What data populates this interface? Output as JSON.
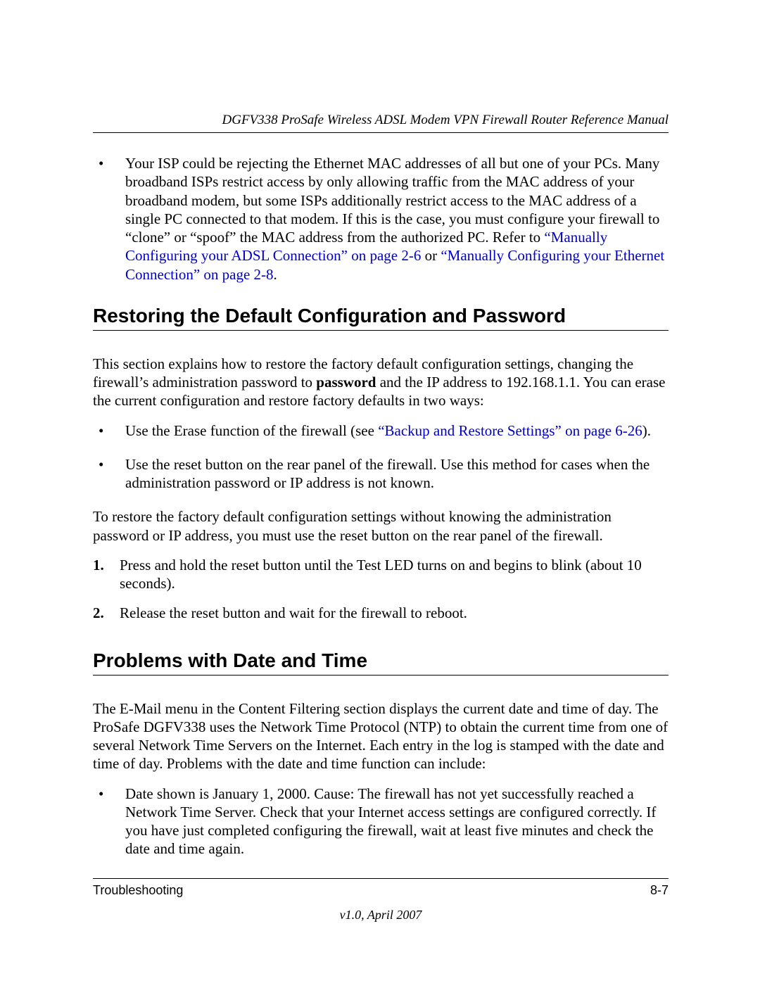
{
  "header": {
    "title": "DGFV338 ProSafe Wireless ADSL Modem VPN Firewall Router Reference Manual"
  },
  "top_bullet": {
    "pre": "Your ISP could be rejecting the Ethernet MAC addresses of all but one of your PCs. Many broadband ISPs restrict access by only allowing traffic from the MAC address of your broadband modem, but some ISPs additionally restrict access to the MAC address of a single PC connected to that modem. If this is the case, you must configure your firewall to “clone” or “spoof” the MAC address from the authorized PC. Refer to ",
    "link1": "“Manually Configuring your ADSL Connection” on page 2-6",
    "mid": " or ",
    "link2": "“Manually Configuring your Ethernet Connection” on page 2-8",
    "post": "."
  },
  "section1": {
    "heading": "Restoring the Default Configuration and Password",
    "intro_pre": "This section explains how to restore the factory default configuration settings, changing the firewall’s administration password to ",
    "intro_bold": "password",
    "intro_post": " and the IP address to 192.168.1.1. You can erase the current configuration and restore factory defaults in two ways:",
    "bullet1_pre": "Use the Erase function of the firewall (see ",
    "bullet1_link": "“Backup and Restore Settings” on page 6-26",
    "bullet1_post": ").",
    "bullet2": "Use the reset button on the rear panel of the firewall. Use this method for cases when the administration password or IP address is not known.",
    "para2": "To restore the factory default configuration settings without knowing the administration password or IP address, you must use the reset button on the rear panel of the firewall.",
    "step1_num": "1.",
    "step1": "Press and hold the reset button until the Test LED turns on and begins to blink (about 10 seconds).",
    "step2_num": "2.",
    "step2": "Release the reset button and wait for the firewall to reboot."
  },
  "section2": {
    "heading": "Problems with Date and Time",
    "para1": "The E-Mail menu in the Content Filtering section displays the current date and time of day. The ProSafe DGFV338 uses the Network Time Protocol (NTP) to obtain the current time from one of several Network Time Servers on the Internet. Each entry in the log is stamped with the date and time of day. Problems with the date and time function can include:",
    "bullet1": "Date shown is January 1, 2000. Cause: The firewall has not yet successfully reached a Network Time Server. Check that your Internet access settings are configured correctly. If you have just completed configuring the firewall, wait at least five minutes and check the date and time again."
  },
  "footer": {
    "left": "Troubleshooting",
    "right": "8-7",
    "version": "v1.0, April 2007"
  }
}
